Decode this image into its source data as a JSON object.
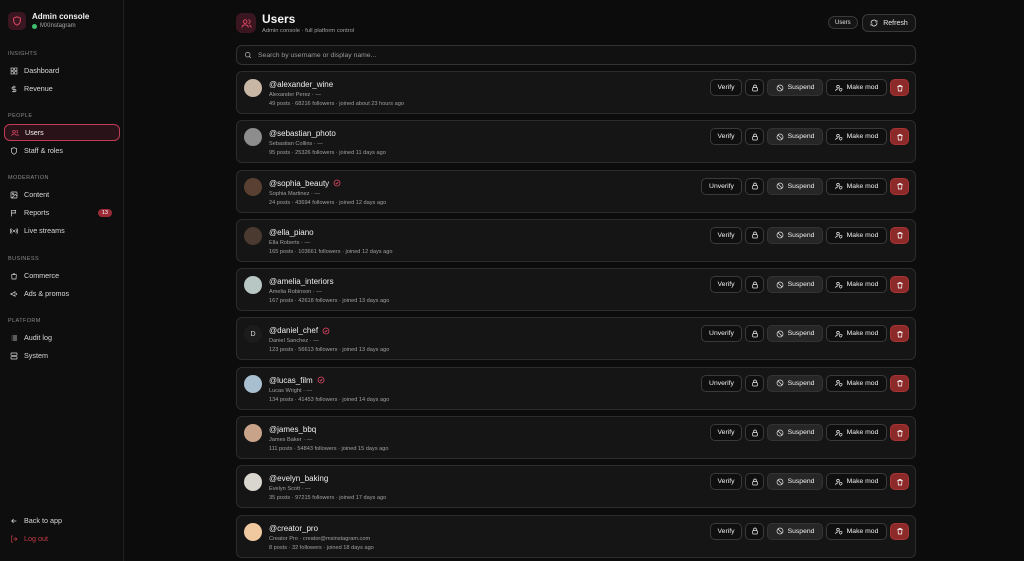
{
  "brand": {
    "title": "Admin console",
    "subtitle": "MXInstagram"
  },
  "sidebar": {
    "sections": [
      {
        "label": "INSIGHTS",
        "items": [
          {
            "label": "Dashboard",
            "icon": "grid-icon"
          },
          {
            "label": "Revenue",
            "icon": "dollar-icon"
          }
        ]
      },
      {
        "label": "PEOPLE",
        "items": [
          {
            "label": "Users",
            "icon": "users-icon",
            "active": true
          },
          {
            "label": "Staff & roles",
            "icon": "shield-icon"
          }
        ]
      },
      {
        "label": "MODERATION",
        "items": [
          {
            "label": "Content",
            "icon": "image-icon"
          },
          {
            "label": "Reports",
            "icon": "flag-icon",
            "badge": "13"
          },
          {
            "label": "Live streams",
            "icon": "radio-icon"
          }
        ]
      },
      {
        "label": "BUSINESS",
        "items": [
          {
            "label": "Commerce",
            "icon": "bag-icon"
          },
          {
            "label": "Ads & promos",
            "icon": "megaphone-icon"
          }
        ]
      },
      {
        "label": "PLATFORM",
        "items": [
          {
            "label": "Audit log",
            "icon": "list-icon"
          },
          {
            "label": "System",
            "icon": "server-icon"
          }
        ]
      }
    ],
    "back_label": "Back to app",
    "logout_label": "Log out"
  },
  "header": {
    "title": "Users",
    "subtitle": "Admin console · full platform control",
    "pill": "Users",
    "refresh_label": "Refresh"
  },
  "search": {
    "placeholder": "Search by username or display name..."
  },
  "actions": {
    "verify": "Verify",
    "unverify": "Unverify",
    "suspend": "Suspend",
    "make_mod": "Make mod"
  },
  "users": [
    {
      "username": "@alexander_wine",
      "display": "Alexander Perez · —",
      "stats": "49 posts · 68216 followers · joined about 23 hours ago",
      "verified": false,
      "avatar_color": "#c9b7a6"
    },
    {
      "username": "@sebastian_photo",
      "display": "Sebastian Collins · —",
      "stats": "95 posts · 25326 followers · joined 11 days ago",
      "verified": false,
      "avatar_color": "#8d8d8d"
    },
    {
      "username": "@sophia_beauty",
      "display": "Sophia Martinez · —",
      "stats": "24 posts · 43694 followers · joined 12 days ago",
      "verified": true,
      "avatar_color": "#5a4032"
    },
    {
      "username": "@ella_piano",
      "display": "Ella Roberts · —",
      "stats": "165 posts · 103661 followers · joined 12 days ago",
      "verified": false,
      "avatar_color": "#4a3a30"
    },
    {
      "username": "@amelia_interiors",
      "display": "Amelia Robinson · —",
      "stats": "167 posts · 42618 followers · joined 13 days ago",
      "verified": false,
      "avatar_color": "#b9c7c4"
    },
    {
      "username": "@daniel_chef",
      "display": "Daniel Sanchez · —",
      "stats": "123 posts · 56613 followers · joined 13 days ago",
      "verified": true,
      "avatar_color": "#1c1c1c",
      "initial": "D"
    },
    {
      "username": "@lucas_film",
      "display": "Lucas Wright · —",
      "stats": "134 posts · 41453 followers · joined 14 days ago",
      "verified": true,
      "avatar_color": "#a8bfd0"
    },
    {
      "username": "@james_bbq",
      "display": "James Baker · —",
      "stats": "111 posts · 54843 followers · joined 15 days ago",
      "verified": false,
      "avatar_color": "#c9a389"
    },
    {
      "username": "@evelyn_baking",
      "display": "Evelyn Scott · —",
      "stats": "35 posts · 97215 followers · joined 17 days ago",
      "verified": false,
      "avatar_color": "#d9d5cf"
    },
    {
      "username": "@creator_pro",
      "display": "Creator Pro · creator@mxinstagram.com",
      "stats": "8 posts · 32 followers · joined 18 days ago",
      "verified": false,
      "avatar_color": "#f0c9a0"
    }
  ],
  "colors": {
    "accent": "#c23c5a",
    "danger": "#8c2a2a",
    "background": "#0c0c0c",
    "card": "#151515"
  }
}
